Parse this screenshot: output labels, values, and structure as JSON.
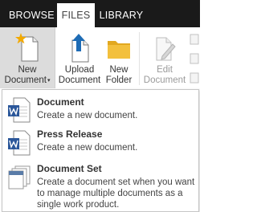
{
  "tabs": {
    "browse": "BROWSE",
    "files": "FILES",
    "library": "LIBRARY"
  },
  "ribbon": {
    "new_document": {
      "line1": "New",
      "line2": "Document",
      "caret": "▾"
    },
    "upload_document": {
      "line1": "Upload",
      "line2": "Document"
    },
    "new_folder": {
      "line1": "New",
      "line2": "Folder"
    },
    "edit_document": {
      "line1": "Edit",
      "line2": "Document"
    }
  },
  "menu": {
    "items": [
      {
        "title": "Document",
        "desc": "Create a new document.",
        "icon": "word-document-icon"
      },
      {
        "title": "Press Release",
        "desc": "Create a new document.",
        "icon": "word-document-icon"
      },
      {
        "title": "Document Set",
        "desc": "Create a document set when you want to manage multiple documents as a single work product.",
        "icon": "document-set-icon"
      }
    ]
  },
  "colors": {
    "tabbar_bg": "#1a1a1a",
    "word_blue": "#2b579a",
    "upload_blue": "#1e6cb5",
    "folder_yellow": "#f3c03d",
    "new_star": "#f2a900"
  }
}
